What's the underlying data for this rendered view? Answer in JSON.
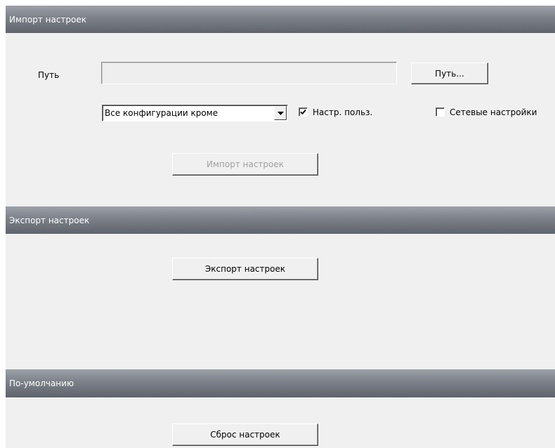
{
  "import_section": {
    "header": "Импорт настроек",
    "path_label": "Путь",
    "path_value": "",
    "browse_button": "Путь...",
    "config_select": {
      "selected": "Все конфигурации кроме"
    },
    "user_settings_checkbox": {
      "label": "Настр. польз.",
      "checked": true
    },
    "network_settings_checkbox": {
      "label": "Сетевые настройки",
      "checked": false
    },
    "import_button": "Импорт настроек",
    "import_button_enabled": false
  },
  "export_section": {
    "header": "Экспорт настроек",
    "export_button": "Экспорт настроек"
  },
  "default_section": {
    "header": "По-умолчанию",
    "reset_button": "Сброс настроек"
  },
  "icons": {
    "dropdown": "chevron-down-icon",
    "check": "checkmark-icon"
  },
  "colors": {
    "header_gradient_top": "#9ca1a8",
    "header_gradient_bottom": "#5f646c",
    "panel_background": "#f0f0f0",
    "disabled_text": "#a0a0a0"
  }
}
